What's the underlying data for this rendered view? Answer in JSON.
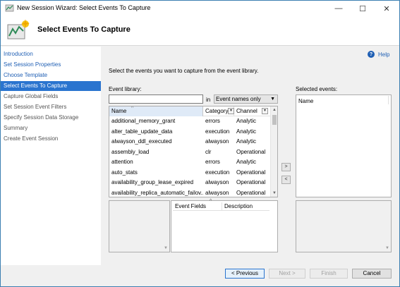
{
  "window": {
    "title": "New Session Wizard: Select Events To Capture",
    "minimize": "—",
    "maximize": "☐",
    "close": "✕"
  },
  "header": {
    "title": "Select Events To Capture"
  },
  "nav": {
    "items": [
      {
        "label": "Introduction",
        "state": "link"
      },
      {
        "label": "Set Session Properties",
        "state": "link"
      },
      {
        "label": "Choose Template",
        "state": "link"
      },
      {
        "label": "Select Events To Capture",
        "state": "active"
      },
      {
        "label": "Capture Global Fields",
        "state": "dim"
      },
      {
        "label": "Set Session Event Filters",
        "state": "dim"
      },
      {
        "label": "Specify Session Data Storage",
        "state": "dim"
      },
      {
        "label": "Summary",
        "state": "dim"
      },
      {
        "label": "Create Event Session",
        "state": "dim"
      }
    ]
  },
  "main": {
    "help": "Help",
    "instruction": "Select the events you want to capture from the event library.",
    "event_library_label": "Event library:",
    "search_value": "",
    "in_label": "in",
    "filter_value": "Event names only",
    "selected_events_label": "Selected events:",
    "selected_column": "Name"
  },
  "grid": {
    "columns": {
      "name": "Name",
      "category": "Category",
      "channel": "Channel"
    },
    "rows": [
      {
        "name": "additional_memory_grant",
        "category": "errors",
        "channel": "Analytic"
      },
      {
        "name": "alter_table_update_data",
        "category": "execution",
        "channel": "Analytic"
      },
      {
        "name": "alwayson_ddl_executed",
        "category": "alwayson",
        "channel": "Analytic"
      },
      {
        "name": "assembly_load",
        "category": "clr",
        "channel": "Operational"
      },
      {
        "name": "attention",
        "category": "errors",
        "channel": "Analytic"
      },
      {
        "name": "auto_stats",
        "category": "execution",
        "channel": "Operational"
      },
      {
        "name": "availability_group_lease_expired",
        "category": "alwayson",
        "channel": "Operational"
      },
      {
        "name": "availability_replica_automatic_failov...",
        "category": "alwayson",
        "channel": "Operational"
      }
    ]
  },
  "event_fields": {
    "fields_header": "Event Fields",
    "description_header": "Description"
  },
  "footer": {
    "previous": "< Previous",
    "next": "Next >",
    "finish": "Finish",
    "cancel": "Cancel"
  },
  "colors": {
    "accent": "#2a74cf",
    "link": "#1f5fb4",
    "background": "#f0f0f0"
  }
}
